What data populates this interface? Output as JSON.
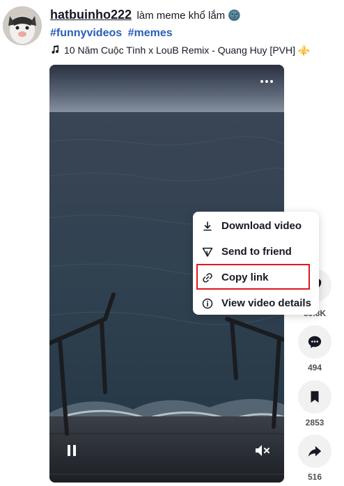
{
  "post": {
    "username": "hatbuinho222",
    "caption": "làm meme khổ lắm 🌚",
    "hashtags": [
      "#funnyvideos",
      "#memes"
    ],
    "music": "10 Năm Cuộc Tình x LouB Remix - Quang Huy [PVH] ⚜️"
  },
  "context_menu": {
    "items": [
      {
        "label": "Download video",
        "icon": "download-icon"
      },
      {
        "label": "Send to friend",
        "icon": "send-icon"
      },
      {
        "label": "Copy link",
        "icon": "link-icon"
      },
      {
        "label": "View video details",
        "icon": "info-icon"
      }
    ],
    "highlighted": "Copy link",
    "highlight_color": "#e0161e"
  },
  "actions": {
    "like_count": "59.8K",
    "comment_count": "494",
    "save_count": "2853",
    "share_count": "516"
  },
  "colors": {
    "hashtag": "#2b5db9",
    "action_bg": "#f1f1f2"
  }
}
